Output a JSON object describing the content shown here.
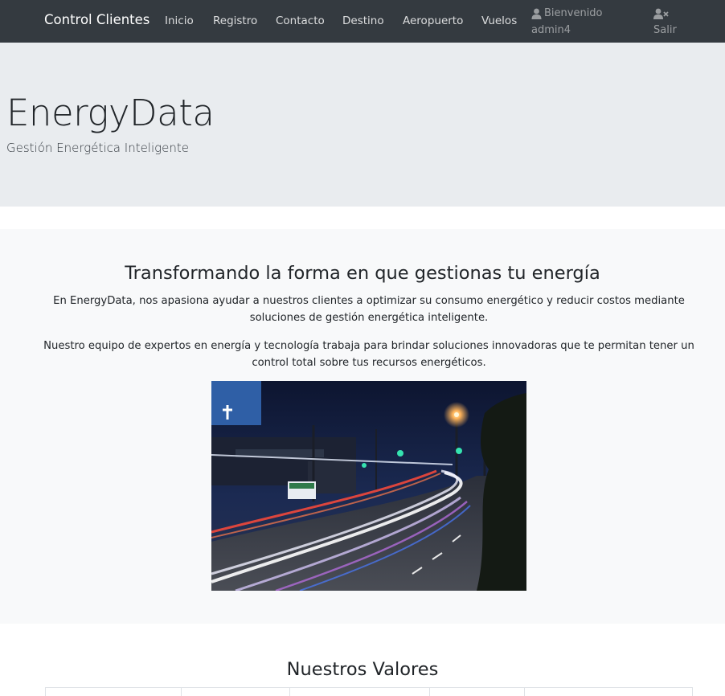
{
  "navbar": {
    "brand": "Control Clientes",
    "links": [
      "Inicio",
      "Registro",
      "Contacto",
      "Destino",
      "Aeropuerto",
      "Vuelos"
    ],
    "welcome": "Bienvenido",
    "username": "admin4",
    "logout": "Salir",
    "icons": {
      "user": "user-icon",
      "logout": "user-times-icon"
    }
  },
  "jumbotron": {
    "title": "EnergyData",
    "subtitle": "Gestión Energética Inteligente"
  },
  "about": {
    "heading": "Transformando la forma en que gestionas tu energía",
    "paragraph1": "En EnergyData, nos apasiona ayudar a nuestros clientes a optimizar su consumo energético y reducir costos mediante soluciones de gestión energética inteligente.",
    "paragraph2": "Nuestro equipo de expertos en energía y tecnología trabaja para brindar soluciones innovadoras que te permitan tener un control total sobre tus recursos energéticos."
  },
  "values": {
    "heading": "Nuestros Valores"
  },
  "colors": {
    "navbar": "#343a40",
    "jumbotron": "#e9ecef",
    "section": "#f8f9fa"
  }
}
